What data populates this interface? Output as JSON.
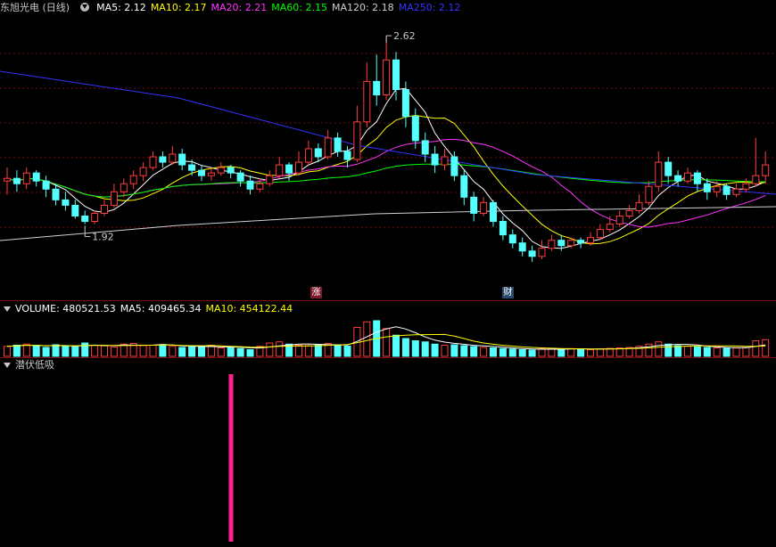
{
  "title": "东旭光电 (日线)",
  "main_indicators": [
    {
      "label": "MA5: 2.12",
      "color": "#ffffff"
    },
    {
      "label": "MA10: 2.17",
      "color": "#ffff00"
    },
    {
      "label": "MA20: 2.21",
      "color": "#ff33ff"
    },
    {
      "label": "MA60: 2.15",
      "color": "#00ff00"
    },
    {
      "label": "MA120: 2.18",
      "color": "#d0d0d0"
    },
    {
      "label": "MA250: 2.12",
      "color": "#3333ff"
    }
  ],
  "volume_header": [
    {
      "label": "VOLUME: 480521.53",
      "color": "#ffffff"
    },
    {
      "label": "MA5: 409465.34",
      "color": "#ffffff"
    },
    {
      "label": "MA10: 454122.44",
      "color": "#ffff00"
    }
  ],
  "indicator_panel_title": "潜伏低吸",
  "annotations": {
    "high": "2.62",
    "low": "1.92",
    "tag1": "涨",
    "tag2": "财"
  },
  "colors": {
    "up": "#ff3c3c",
    "down": "#54ffff",
    "grid": "#7a0d0d",
    "signal": "#ff1f8f"
  },
  "chart_data": {
    "type": "candlestick",
    "price_high_label": 2.62,
    "price_low_label": 1.92,
    "candles": [
      [
        2.08,
        2.09,
        2.03,
        2.13
      ],
      [
        2.09,
        2.07,
        2.04,
        2.12
      ],
      [
        2.07,
        2.11,
        2.05,
        2.13
      ],
      [
        2.11,
        2.08,
        2.06,
        2.12
      ],
      [
        2.08,
        2.05,
        2.02,
        2.1
      ],
      [
        2.05,
        2.01,
        1.99,
        2.07
      ],
      [
        2.01,
        1.99,
        1.97,
        2.04
      ],
      [
        1.99,
        1.95,
        1.94,
        2.01
      ],
      [
        1.95,
        1.93,
        1.92,
        1.97
      ],
      [
        1.93,
        1.96,
        1.92,
        1.97
      ],
      [
        1.96,
        1.99,
        1.95,
        2.01
      ],
      [
        1.99,
        2.04,
        1.98,
        2.07
      ],
      [
        2.04,
        2.07,
        2.02,
        2.09
      ],
      [
        2.07,
        2.1,
        2.05,
        2.12
      ],
      [
        2.1,
        2.13,
        2.08,
        2.15
      ],
      [
        2.13,
        2.17,
        2.12,
        2.19
      ],
      [
        2.17,
        2.15,
        2.13,
        2.19
      ],
      [
        2.15,
        2.18,
        2.14,
        2.21
      ],
      [
        2.18,
        2.14,
        2.12,
        2.2
      ],
      [
        2.14,
        2.12,
        2.1,
        2.16
      ],
      [
        2.12,
        2.1,
        2.08,
        2.14
      ],
      [
        2.1,
        2.11,
        2.08,
        2.13
      ],
      [
        2.11,
        2.13,
        2.1,
        2.15
      ],
      [
        2.13,
        2.11,
        2.09,
        2.14
      ],
      [
        2.11,
        2.08,
        2.06,
        2.12
      ],
      [
        2.08,
        2.05,
        2.03,
        2.1
      ],
      [
        2.05,
        2.07,
        2.04,
        2.09
      ],
      [
        2.07,
        2.1,
        2.06,
        2.12
      ],
      [
        2.1,
        2.14,
        2.09,
        2.17
      ],
      [
        2.14,
        2.11,
        2.08,
        2.15
      ],
      [
        2.11,
        2.15,
        2.1,
        2.19
      ],
      [
        2.15,
        2.2,
        2.14,
        2.23
      ],
      [
        2.2,
        2.17,
        2.15,
        2.22
      ],
      [
        2.17,
        2.24,
        2.16,
        2.27
      ],
      [
        2.24,
        2.19,
        2.17,
        2.26
      ],
      [
        2.19,
        2.16,
        2.13,
        2.21
      ],
      [
        2.16,
        2.3,
        2.15,
        2.36
      ],
      [
        2.3,
        2.45,
        2.28,
        2.52
      ],
      [
        2.45,
        2.4,
        2.36,
        2.55
      ],
      [
        2.4,
        2.53,
        2.38,
        2.62
      ],
      [
        2.53,
        2.42,
        2.38,
        2.56
      ],
      [
        2.42,
        2.32,
        2.28,
        2.45
      ],
      [
        2.32,
        2.23,
        2.2,
        2.35
      ],
      [
        2.23,
        2.18,
        2.15,
        2.26
      ],
      [
        2.18,
        2.14,
        2.11,
        2.21
      ],
      [
        2.14,
        2.17,
        2.12,
        2.2
      ],
      [
        2.17,
        2.1,
        2.08,
        2.19
      ],
      [
        2.1,
        2.02,
        1.99,
        2.12
      ],
      [
        2.02,
        1.96,
        1.93,
        2.04
      ],
      [
        1.96,
        2.0,
        1.95,
        2.02
      ],
      [
        2.0,
        1.93,
        1.91,
        2.01
      ],
      [
        1.93,
        1.88,
        1.86,
        1.95
      ],
      [
        1.88,
        1.85,
        1.83,
        1.9
      ],
      [
        1.85,
        1.82,
        1.8,
        1.87
      ],
      [
        1.82,
        1.8,
        1.78,
        1.84
      ],
      [
        1.8,
        1.83,
        1.79,
        1.86
      ],
      [
        1.83,
        1.86,
        1.82,
        1.88
      ],
      [
        1.86,
        1.84,
        1.82,
        1.88
      ],
      [
        1.84,
        1.86,
        1.83,
        1.87
      ],
      [
        1.86,
        1.85,
        1.83,
        1.87
      ],
      [
        1.85,
        1.87,
        1.84,
        1.89
      ],
      [
        1.87,
        1.9,
        1.86,
        1.92
      ],
      [
        1.9,
        1.92,
        1.89,
        1.95
      ],
      [
        1.92,
        1.95,
        1.91,
        1.97
      ],
      [
        1.95,
        1.97,
        1.94,
        1.99
      ],
      [
        1.97,
        2.0,
        1.96,
        2.03
      ],
      [
        2.0,
        2.06,
        1.99,
        2.08
      ],
      [
        2.06,
        2.15,
        2.04,
        2.19
      ],
      [
        2.15,
        2.1,
        2.07,
        2.17
      ],
      [
        2.1,
        2.08,
        2.06,
        2.12
      ],
      [
        2.08,
        2.11,
        2.07,
        2.13
      ],
      [
        2.11,
        2.07,
        2.04,
        2.12
      ],
      [
        2.07,
        2.04,
        2.01,
        2.09
      ],
      [
        2.04,
        2.06,
        2.02,
        2.08
      ],
      [
        2.06,
        2.03,
        2.01,
        2.07
      ],
      [
        2.03,
        2.05,
        2.02,
        2.07
      ],
      [
        2.05,
        2.07,
        2.04,
        2.09
      ],
      [
        2.07,
        2.1,
        2.06,
        2.24
      ],
      [
        2.1,
        2.14,
        2.07,
        2.19
      ]
    ],
    "volume": [
      0.45,
      0.5,
      0.55,
      0.48,
      0.4,
      0.52,
      0.46,
      0.44,
      0.6,
      0.5,
      0.47,
      0.42,
      0.55,
      0.58,
      0.48,
      0.5,
      0.53,
      0.45,
      0.4,
      0.42,
      0.43,
      0.5,
      0.38,
      0.4,
      0.35,
      0.3,
      0.45,
      0.6,
      0.65,
      0.55,
      0.5,
      0.48,
      0.52,
      0.58,
      0.5,
      0.46,
      1.3,
      1.55,
      1.6,
      1.25,
      0.95,
      0.8,
      0.7,
      0.65,
      0.55,
      0.5,
      0.52,
      0.48,
      0.44,
      0.4,
      0.38,
      0.35,
      0.33,
      0.3,
      0.28,
      0.34,
      0.36,
      0.32,
      0.35,
      0.33,
      0.3,
      0.34,
      0.36,
      0.38,
      0.4,
      0.45,
      0.55,
      0.65,
      0.55,
      0.48,
      0.45,
      0.42,
      0.4,
      0.38,
      0.36,
      0.38,
      0.4,
      0.7,
      0.75
    ],
    "signal_index": 30
  }
}
